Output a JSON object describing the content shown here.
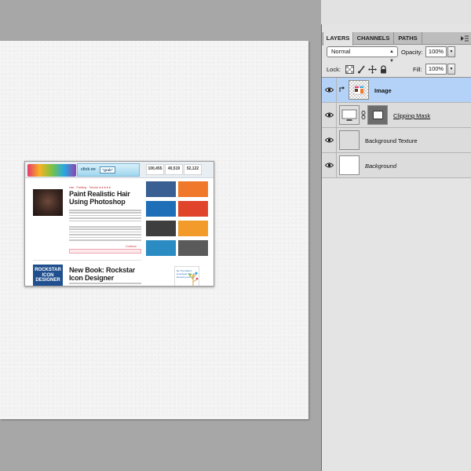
{
  "panel": {
    "tabs": [
      "LAYERS",
      "CHANNELS",
      "PATHS"
    ],
    "blend_mode": "Normal",
    "opacity_label": "Opacity:",
    "opacity_value": "100%",
    "lock_label": "Lock:",
    "fill_label": "Fill:",
    "fill_value": "100%"
  },
  "layers": [
    {
      "name": "Image",
      "selected": true,
      "clipped": true
    },
    {
      "name": "Clipping Mask",
      "selected": false,
      "has_mask": true
    },
    {
      "name": "Background Texture",
      "selected": false
    },
    {
      "name": "Background",
      "selected": false,
      "locked": true
    }
  ],
  "site": {
    "click_text": "click on",
    "click_button": "\"grab\"",
    "stats": [
      "100,455",
      "40,519",
      "52,122"
    ],
    "article1_meta": "Hair · Painting · Tutorial ★★★★★",
    "article1_title": "Paint Realistic Hair Using Photoshop",
    "article1_readmore": "Continue",
    "article2_badge": "ROCKSTAR ICON DESIGNER",
    "article2_title": "New Book: Rockstar Icon Designer",
    "widget_text": "Be The Match! leveraged IT to find lifesaving donors"
  },
  "colors": {
    "selection": "#b4d2f7",
    "canvas": "#f4f4f4",
    "workspace": "#a7a7a7",
    "panel": "#e4e4e4"
  }
}
